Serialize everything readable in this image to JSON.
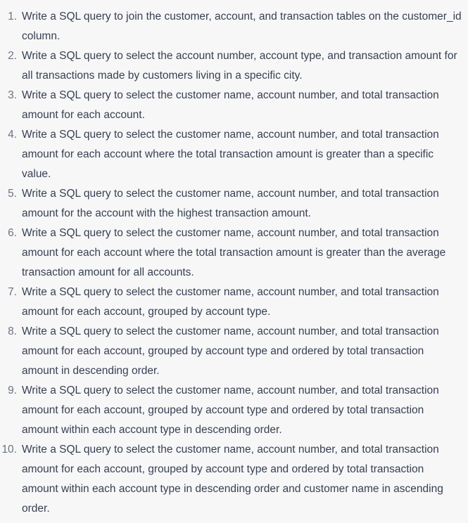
{
  "items": [
    {
      "number": "1.",
      "text": "Write a SQL query to join the customer, account, and transaction tables on the customer_id column."
    },
    {
      "number": "2.",
      "text": "Write a SQL query to select the account number, account type, and transaction amount for all transactions made by customers living in a specific city."
    },
    {
      "number": "3.",
      "text": "Write a SQL query to select the customer name, account number, and total transaction amount for each account."
    },
    {
      "number": "4.",
      "text": "Write a SQL query to select the customer name, account number, and total transaction amount for each account where the total transaction amount is greater than a specific value."
    },
    {
      "number": "5.",
      "text": "Write a SQL query to select the customer name, account number, and total transaction amount for the account with the highest transaction amount."
    },
    {
      "number": "6.",
      "text": "Write a SQL query to select the customer name, account number, and total transaction amount for each account where the total transaction amount is greater than the average transaction amount for all accounts."
    },
    {
      "number": "7.",
      "text": "Write a SQL query to select the customer name, account number, and total transaction amount for each account, grouped by account type."
    },
    {
      "number": "8.",
      "text": "Write a SQL query to select the customer name, account number, and total transaction amount for each account, grouped by account type and ordered by total transaction amount in descending order."
    },
    {
      "number": "9.",
      "text": "Write a SQL query to select the customer name, account number, and total transaction amount for each account, grouped by account type and ordered by total transaction amount within each account type in descending order."
    },
    {
      "number": "10.",
      "text": "Write a SQL query to select the customer name, account number, and total transaction amount for each account, grouped by account type and ordered by total transaction amount within each account type in descending order and customer name in ascending order."
    }
  ]
}
